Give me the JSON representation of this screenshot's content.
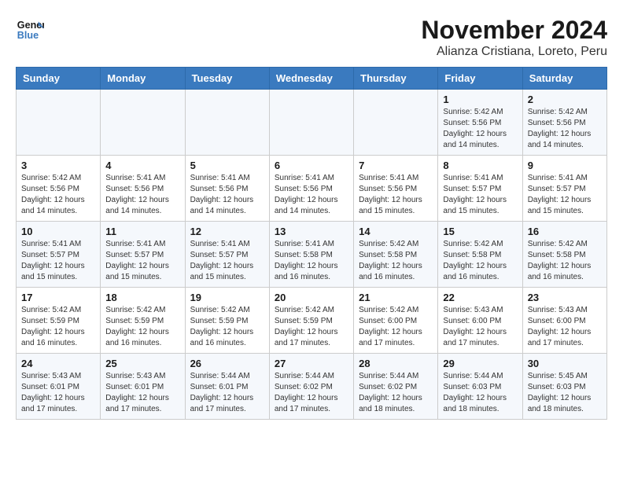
{
  "logo": {
    "line1": "General",
    "line2": "Blue"
  },
  "title": "November 2024",
  "subtitle": "Alianza Cristiana, Loreto, Peru",
  "weekdays": [
    "Sunday",
    "Monday",
    "Tuesday",
    "Wednesday",
    "Thursday",
    "Friday",
    "Saturday"
  ],
  "weeks": [
    [
      {
        "day": "",
        "info": ""
      },
      {
        "day": "",
        "info": ""
      },
      {
        "day": "",
        "info": ""
      },
      {
        "day": "",
        "info": ""
      },
      {
        "day": "",
        "info": ""
      },
      {
        "day": "1",
        "info": "Sunrise: 5:42 AM\nSunset: 5:56 PM\nDaylight: 12 hours\nand 14 minutes."
      },
      {
        "day": "2",
        "info": "Sunrise: 5:42 AM\nSunset: 5:56 PM\nDaylight: 12 hours\nand 14 minutes."
      }
    ],
    [
      {
        "day": "3",
        "info": "Sunrise: 5:42 AM\nSunset: 5:56 PM\nDaylight: 12 hours\nand 14 minutes."
      },
      {
        "day": "4",
        "info": "Sunrise: 5:41 AM\nSunset: 5:56 PM\nDaylight: 12 hours\nand 14 minutes."
      },
      {
        "day": "5",
        "info": "Sunrise: 5:41 AM\nSunset: 5:56 PM\nDaylight: 12 hours\nand 14 minutes."
      },
      {
        "day": "6",
        "info": "Sunrise: 5:41 AM\nSunset: 5:56 PM\nDaylight: 12 hours\nand 14 minutes."
      },
      {
        "day": "7",
        "info": "Sunrise: 5:41 AM\nSunset: 5:56 PM\nDaylight: 12 hours\nand 15 minutes."
      },
      {
        "day": "8",
        "info": "Sunrise: 5:41 AM\nSunset: 5:57 PM\nDaylight: 12 hours\nand 15 minutes."
      },
      {
        "day": "9",
        "info": "Sunrise: 5:41 AM\nSunset: 5:57 PM\nDaylight: 12 hours\nand 15 minutes."
      }
    ],
    [
      {
        "day": "10",
        "info": "Sunrise: 5:41 AM\nSunset: 5:57 PM\nDaylight: 12 hours\nand 15 minutes."
      },
      {
        "day": "11",
        "info": "Sunrise: 5:41 AM\nSunset: 5:57 PM\nDaylight: 12 hours\nand 15 minutes."
      },
      {
        "day": "12",
        "info": "Sunrise: 5:41 AM\nSunset: 5:57 PM\nDaylight: 12 hours\nand 15 minutes."
      },
      {
        "day": "13",
        "info": "Sunrise: 5:41 AM\nSunset: 5:58 PM\nDaylight: 12 hours\nand 16 minutes."
      },
      {
        "day": "14",
        "info": "Sunrise: 5:42 AM\nSunset: 5:58 PM\nDaylight: 12 hours\nand 16 minutes."
      },
      {
        "day": "15",
        "info": "Sunrise: 5:42 AM\nSunset: 5:58 PM\nDaylight: 12 hours\nand 16 minutes."
      },
      {
        "day": "16",
        "info": "Sunrise: 5:42 AM\nSunset: 5:58 PM\nDaylight: 12 hours\nand 16 minutes."
      }
    ],
    [
      {
        "day": "17",
        "info": "Sunrise: 5:42 AM\nSunset: 5:59 PM\nDaylight: 12 hours\nand 16 minutes."
      },
      {
        "day": "18",
        "info": "Sunrise: 5:42 AM\nSunset: 5:59 PM\nDaylight: 12 hours\nand 16 minutes."
      },
      {
        "day": "19",
        "info": "Sunrise: 5:42 AM\nSunset: 5:59 PM\nDaylight: 12 hours\nand 16 minutes."
      },
      {
        "day": "20",
        "info": "Sunrise: 5:42 AM\nSunset: 5:59 PM\nDaylight: 12 hours\nand 17 minutes."
      },
      {
        "day": "21",
        "info": "Sunrise: 5:42 AM\nSunset: 6:00 PM\nDaylight: 12 hours\nand 17 minutes."
      },
      {
        "day": "22",
        "info": "Sunrise: 5:43 AM\nSunset: 6:00 PM\nDaylight: 12 hours\nand 17 minutes."
      },
      {
        "day": "23",
        "info": "Sunrise: 5:43 AM\nSunset: 6:00 PM\nDaylight: 12 hours\nand 17 minutes."
      }
    ],
    [
      {
        "day": "24",
        "info": "Sunrise: 5:43 AM\nSunset: 6:01 PM\nDaylight: 12 hours\nand 17 minutes."
      },
      {
        "day": "25",
        "info": "Sunrise: 5:43 AM\nSunset: 6:01 PM\nDaylight: 12 hours\nand 17 minutes."
      },
      {
        "day": "26",
        "info": "Sunrise: 5:44 AM\nSunset: 6:01 PM\nDaylight: 12 hours\nand 17 minutes."
      },
      {
        "day": "27",
        "info": "Sunrise: 5:44 AM\nSunset: 6:02 PM\nDaylight: 12 hours\nand 17 minutes."
      },
      {
        "day": "28",
        "info": "Sunrise: 5:44 AM\nSunset: 6:02 PM\nDaylight: 12 hours\nand 18 minutes."
      },
      {
        "day": "29",
        "info": "Sunrise: 5:44 AM\nSunset: 6:03 PM\nDaylight: 12 hours\nand 18 minutes."
      },
      {
        "day": "30",
        "info": "Sunrise: 5:45 AM\nSunset: 6:03 PM\nDaylight: 12 hours\nand 18 minutes."
      }
    ]
  ]
}
